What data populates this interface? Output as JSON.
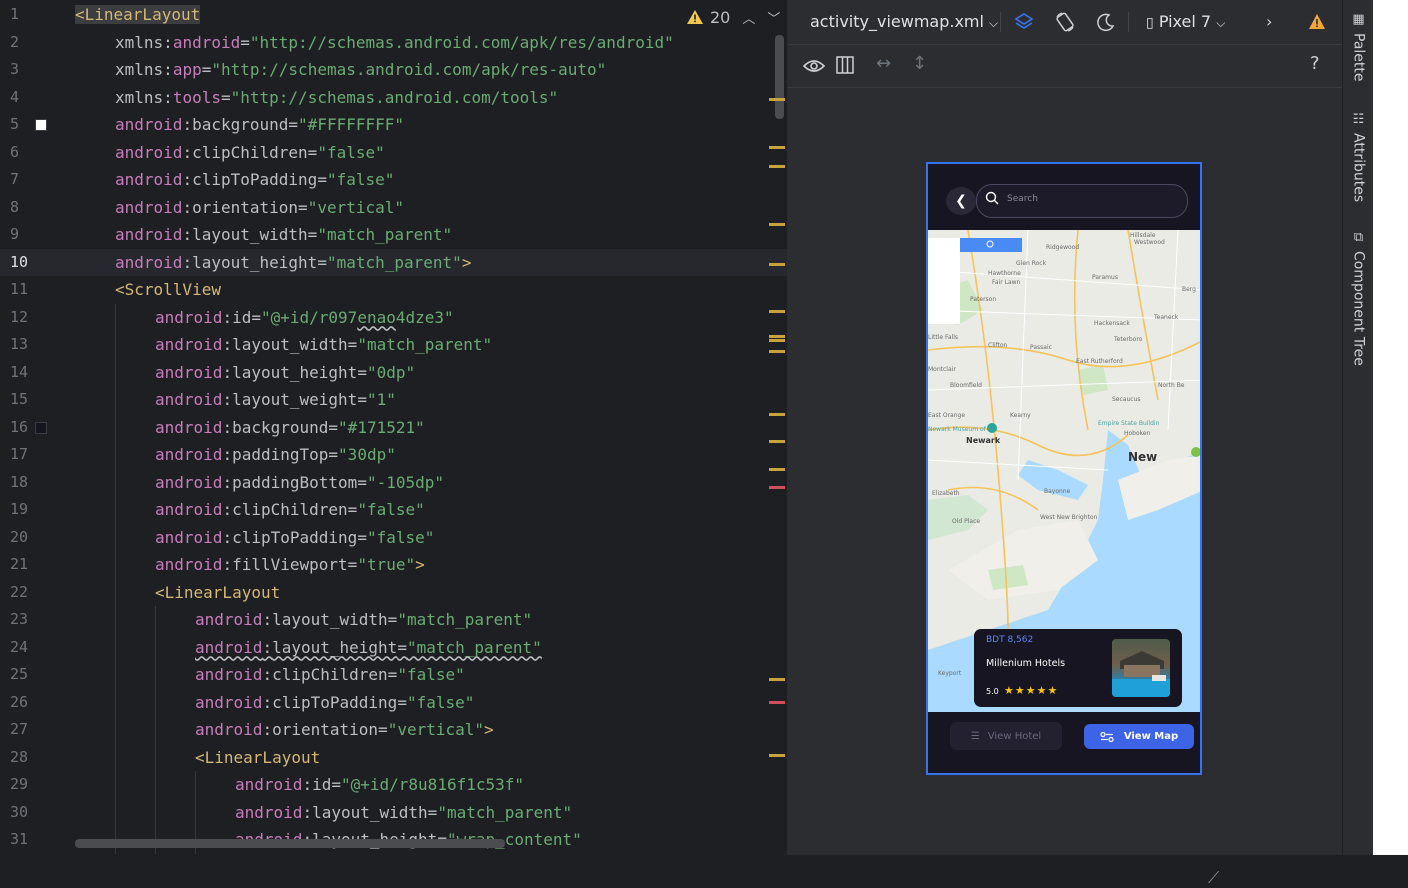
{
  "editor": {
    "warning_count": "20",
    "lines": [
      {
        "n": "1",
        "indent": 0,
        "parts": [
          [
            "tag",
            "<LinearLayout"
          ]
        ]
      },
      {
        "n": "2",
        "indent": 1,
        "parts": [
          [
            "attr",
            "xmlns"
          ],
          [
            "punc",
            ":"
          ],
          [
            "ns",
            "android"
          ],
          [
            "punc",
            "="
          ],
          [
            "val",
            "\"http://schemas.android.com/apk/res/android\""
          ]
        ]
      },
      {
        "n": "3",
        "indent": 1,
        "parts": [
          [
            "attr",
            "xmlns"
          ],
          [
            "punc",
            ":"
          ],
          [
            "ns",
            "app"
          ],
          [
            "punc",
            "="
          ],
          [
            "val",
            "\"http://schemas.android.com/apk/res-auto\""
          ]
        ]
      },
      {
        "n": "4",
        "indent": 1,
        "parts": [
          [
            "attr",
            "xmlns"
          ],
          [
            "punc",
            ":"
          ],
          [
            "ns",
            "tools"
          ],
          [
            "punc",
            "="
          ],
          [
            "val",
            "\"http://schemas.android.com/tools\""
          ]
        ]
      },
      {
        "n": "5",
        "indent": 1,
        "parts": [
          [
            "ns",
            "android"
          ],
          [
            "punc",
            ":"
          ],
          [
            "attr",
            "background"
          ],
          [
            "punc",
            "="
          ],
          [
            "val",
            "\"#FFFFFFFF\""
          ]
        ]
      },
      {
        "n": "6",
        "indent": 1,
        "parts": [
          [
            "ns",
            "android"
          ],
          [
            "punc",
            ":"
          ],
          [
            "attr",
            "clipChildren"
          ],
          [
            "punc",
            "="
          ],
          [
            "val",
            "\"false\""
          ]
        ]
      },
      {
        "n": "7",
        "indent": 1,
        "parts": [
          [
            "ns",
            "android"
          ],
          [
            "punc",
            ":"
          ],
          [
            "attr",
            "clipToPadding"
          ],
          [
            "punc",
            "="
          ],
          [
            "val",
            "\"false\""
          ]
        ]
      },
      {
        "n": "8",
        "indent": 1,
        "parts": [
          [
            "ns",
            "android"
          ],
          [
            "punc",
            ":"
          ],
          [
            "attr",
            "orientation"
          ],
          [
            "punc",
            "="
          ],
          [
            "val",
            "\"vertical\""
          ]
        ]
      },
      {
        "n": "9",
        "indent": 1,
        "parts": [
          [
            "ns",
            "android"
          ],
          [
            "punc",
            ":"
          ],
          [
            "attr",
            "layout_width"
          ],
          [
            "punc",
            "="
          ],
          [
            "val",
            "\"match_parent\""
          ]
        ]
      },
      {
        "n": "10",
        "indent": 1,
        "parts": [
          [
            "ns",
            "android"
          ],
          [
            "punc",
            ":"
          ],
          [
            "attr",
            "layout_height"
          ],
          [
            "punc",
            "="
          ],
          [
            "val",
            "\"match_parent\""
          ],
          [
            "tag",
            ">"
          ]
        ]
      },
      {
        "n": "11",
        "indent": 1,
        "parts": [
          [
            "tag",
            "<ScrollView"
          ]
        ]
      },
      {
        "n": "12",
        "indent": 2,
        "parts": [
          [
            "ns",
            "android"
          ],
          [
            "punc",
            ":"
          ],
          [
            "attr",
            "id"
          ],
          [
            "punc",
            "="
          ],
          [
            "val",
            "\"@+id/r097"
          ],
          [
            "valsq",
            "enao"
          ],
          [
            "val",
            "4dze3\""
          ]
        ]
      },
      {
        "n": "13",
        "indent": 2,
        "parts": [
          [
            "ns",
            "android"
          ],
          [
            "punc",
            ":"
          ],
          [
            "attr",
            "layout_width"
          ],
          [
            "punc",
            "="
          ],
          [
            "val",
            "\"match_parent\""
          ]
        ]
      },
      {
        "n": "14",
        "indent": 2,
        "parts": [
          [
            "ns",
            "android"
          ],
          [
            "punc",
            ":"
          ],
          [
            "attr",
            "layout_height"
          ],
          [
            "punc",
            "="
          ],
          [
            "val",
            "\"0dp\""
          ]
        ]
      },
      {
        "n": "15",
        "indent": 2,
        "parts": [
          [
            "ns",
            "android"
          ],
          [
            "punc",
            ":"
          ],
          [
            "attr",
            "layout_weight"
          ],
          [
            "punc",
            "="
          ],
          [
            "val",
            "\"1\""
          ]
        ]
      },
      {
        "n": "16",
        "indent": 2,
        "parts": [
          [
            "ns",
            "android"
          ],
          [
            "punc",
            ":"
          ],
          [
            "attr",
            "background"
          ],
          [
            "punc",
            "="
          ],
          [
            "val",
            "\"#171521\""
          ]
        ]
      },
      {
        "n": "17",
        "indent": 2,
        "parts": [
          [
            "ns",
            "android"
          ],
          [
            "punc",
            ":"
          ],
          [
            "attr",
            "paddingTop"
          ],
          [
            "punc",
            "="
          ],
          [
            "val",
            "\"30dp\""
          ]
        ]
      },
      {
        "n": "18",
        "indent": 2,
        "parts": [
          [
            "ns",
            "android"
          ],
          [
            "punc",
            ":"
          ],
          [
            "attr",
            "paddingBottom"
          ],
          [
            "punc",
            "="
          ],
          [
            "val",
            "\"-105dp\""
          ]
        ]
      },
      {
        "n": "19",
        "indent": 2,
        "parts": [
          [
            "ns",
            "android"
          ],
          [
            "punc",
            ":"
          ],
          [
            "attr",
            "clipChildren"
          ],
          [
            "punc",
            "="
          ],
          [
            "val",
            "\"false\""
          ]
        ]
      },
      {
        "n": "20",
        "indent": 2,
        "parts": [
          [
            "ns",
            "android"
          ],
          [
            "punc",
            ":"
          ],
          [
            "attr",
            "clipToPadding"
          ],
          [
            "punc",
            "="
          ],
          [
            "val",
            "\"false\""
          ]
        ]
      },
      {
        "n": "21",
        "indent": 2,
        "parts": [
          [
            "ns",
            "android"
          ],
          [
            "punc",
            ":"
          ],
          [
            "attr",
            "fillViewport"
          ],
          [
            "punc",
            "="
          ],
          [
            "val",
            "\"true\""
          ],
          [
            "tag",
            ">"
          ]
        ]
      },
      {
        "n": "22",
        "indent": 2,
        "parts": [
          [
            "tag",
            "<LinearLayout"
          ]
        ]
      },
      {
        "n": "23",
        "indent": 3,
        "parts": [
          [
            "ns",
            "android"
          ],
          [
            "punc",
            ":"
          ],
          [
            "attr",
            "layout_width"
          ],
          [
            "punc",
            "="
          ],
          [
            "val",
            "\"match_parent\""
          ]
        ]
      },
      {
        "n": "24",
        "indent": 3,
        "parts": [
          [
            "nssq",
            "android"
          ],
          [
            "puncsq",
            ":"
          ],
          [
            "attrsq",
            "layout_height"
          ],
          [
            "puncsq",
            "="
          ],
          [
            "valsq",
            "\"match_parent\""
          ]
        ]
      },
      {
        "n": "25",
        "indent": 3,
        "parts": [
          [
            "ns",
            "android"
          ],
          [
            "punc",
            ":"
          ],
          [
            "attr",
            "clipChildren"
          ],
          [
            "punc",
            "="
          ],
          [
            "val",
            "\"false\""
          ]
        ]
      },
      {
        "n": "26",
        "indent": 3,
        "parts": [
          [
            "ns",
            "android"
          ],
          [
            "punc",
            ":"
          ],
          [
            "attr",
            "clipToPadding"
          ],
          [
            "punc",
            "="
          ],
          [
            "val",
            "\"false\""
          ]
        ]
      },
      {
        "n": "27",
        "indent": 3,
        "parts": [
          [
            "ns",
            "android"
          ],
          [
            "punc",
            ":"
          ],
          [
            "attr",
            "orientation"
          ],
          [
            "punc",
            "="
          ],
          [
            "val",
            "\"vertical\""
          ],
          [
            "tag",
            ">"
          ]
        ]
      },
      {
        "n": "28",
        "indent": 3,
        "parts": [
          [
            "tag",
            "<LinearLayout"
          ]
        ]
      },
      {
        "n": "29",
        "indent": 4,
        "parts": [
          [
            "ns",
            "android"
          ],
          [
            "punc",
            ":"
          ],
          [
            "attr",
            "id"
          ],
          [
            "punc",
            "="
          ],
          [
            "val",
            "\"@+id/r8u816f1c53f\""
          ]
        ]
      },
      {
        "n": "30",
        "indent": 4,
        "parts": [
          [
            "ns",
            "android"
          ],
          [
            "punc",
            ":"
          ],
          [
            "attr",
            "layout_width"
          ],
          [
            "punc",
            "="
          ],
          [
            "val",
            "\"match_parent\""
          ]
        ]
      },
      {
        "n": "31",
        "indent": 4,
        "parts": [
          [
            "ns",
            "android"
          ],
          [
            "punc",
            ":"
          ],
          [
            "attr",
            "layout_height"
          ],
          [
            "punc",
            "="
          ],
          [
            "val",
            "\"wrap_content\""
          ]
        ]
      }
    ],
    "current_line": "10",
    "gutter_swatches": [
      {
        "line": "5",
        "color": "#FFFFFFFF"
      },
      {
        "line": "16",
        "color": "#171521"
      }
    ],
    "marker_colors": [
      "#c9a23c",
      "#c9a23c",
      "#c9a23c",
      "#c9a23c",
      "#c9a23c",
      "#c9a23c",
      "#c9a23c",
      "#c9a23c",
      "#c9a23c",
      "#c9a23c",
      "#c9a23c",
      "#c9a23c",
      "#d14e5a",
      "#c9a23c",
      "#d14e5a",
      "#c9a23c"
    ]
  },
  "design_toolbar": {
    "file_name": "activity_viewmap.xml",
    "device": "Pixel 7",
    "help": "?"
  },
  "phone": {
    "search_placeholder": "Search",
    "hotel_card": {
      "price": "BDT 8,562",
      "name": "Millenium Hotels",
      "rating": "5.0",
      "stars": "★★★★★"
    },
    "buttons": {
      "view_hotel": "View Hotel",
      "view_map": "View Map"
    },
    "map_labels": [
      "Ridgewood",
      "Hillsdale",
      "Westwood",
      "Glen Rock",
      "Paramus",
      "Hawthorne",
      "Fair Lawn",
      "Paterson",
      "Hackensack",
      "Teaneck",
      "Berg",
      "Clifton",
      "Passaic",
      "Teterboro",
      "Little Falls",
      "East Rutherford",
      "Montclair",
      "Bloomfield",
      "North Be",
      "Secaucus",
      "East Orange",
      "Kearny",
      "Empire State Buildin",
      "Newark",
      "Hoboken",
      "New",
      "Elizabeth",
      "Bayonne",
      "West New Brighton",
      "Old Place",
      "Keyport",
      "Newark Museum of Art"
    ]
  },
  "toolstrip": {
    "palette": "Palette",
    "attributes": "Attributes",
    "component_tree": "Component Tree"
  },
  "colors": {
    "accent": "#3574f0",
    "button_primary": "#3d63e6",
    "star": "#f5c518",
    "warning": "#f2c94c"
  }
}
